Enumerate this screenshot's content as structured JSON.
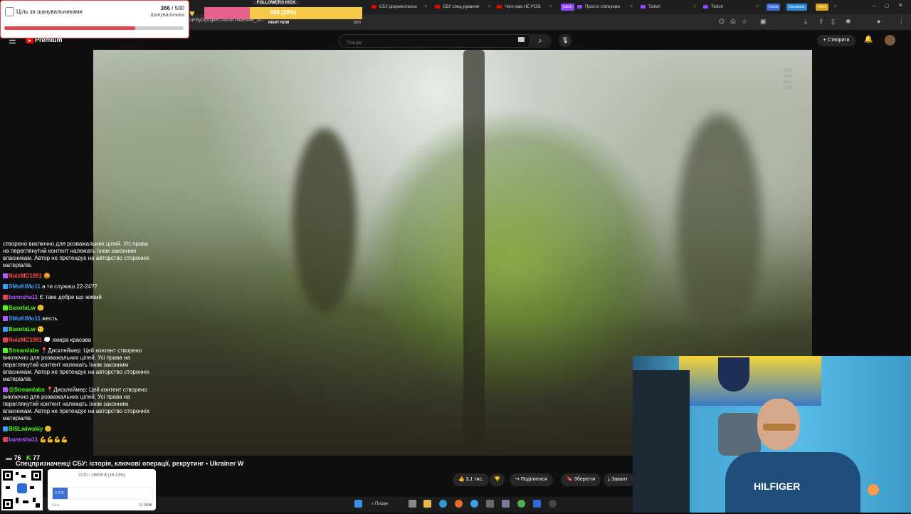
{
  "browser": {
    "tabs": [
      {
        "label": "СБУ документальн",
        "icon": "youtube-icon"
      },
      {
        "label": "СБУ спец-рування",
        "icon": "youtube-icon"
      },
      {
        "label": "Чого нам НЕ РОЗІ",
        "icon": "youtube-icon"
      },
      {
        "label": "Просто спілкуємо",
        "icon": "twitch-icon"
      },
      {
        "label": "Twitch",
        "icon": "twitch-icon"
      },
      {
        "label": "Twitch",
        "icon": "twitch-icon"
      }
    ],
    "pills": [
      "twitch",
      "Donat",
      "Donations",
      "Films"
    ],
    "url": "C4FByDIpUg4ECABAIK-ndaE8MB_2x..."
  },
  "follower_goal": {
    "title": "Ціль за шанувальниками",
    "current": "366",
    "total": "500",
    "label": "Шанувальники",
    "progress": 0.732
  },
  "followers_kick": {
    "label": "FOLLOWERS KICK",
    "value": "288 (28%)",
    "right_now": "RIGHT NOW",
    "max": "1000",
    "progress": 0.288
  },
  "youtube": {
    "logo": "Premium",
    "search_placeholder": "Пошук",
    "create_label": "Створити",
    "video_badge": [
      "RTX",
      "VSR",
      "RTX",
      "HDR"
    ],
    "title": "Спецпризначенці СБУ: історія, ключові операції, рекрутинг • Ukraїner W",
    "likes": "3,1 тис.",
    "share": "Поділитися",
    "save": "Зберегти",
    "download": "Завант"
  },
  "chat": {
    "stats": {
      "viewers": "76",
      "kick": "77"
    },
    "messages": [
      {
        "nick": "",
        "text": "створено виключно для розважальних цілей. Усі права на переглянутий контент належать їхнім законним власникам. Автор не претендує на авторство сторонніх матеріалів.",
        "color": "#ffffff"
      },
      {
        "nick": "NoizMC1991",
        "text": "😡",
        "color": "#ff4f4f"
      },
      {
        "nick": "SMoKiMo11",
        "text": "а ти служиш 22-24??",
        "color": "#3aa0ff"
      },
      {
        "nick": "bannsha11",
        "text": "Є таке добре що живий",
        "color": "#b05cff"
      },
      {
        "nick": "BasotaLw",
        "text": "🙂",
        "color": "#53fc18"
      },
      {
        "nick": "SMoKiMo11",
        "text": "жесть",
        "color": "#3aa0ff"
      },
      {
        "nick": "BasotaLw",
        "text": "🙂",
        "color": "#53fc18"
      },
      {
        "nick": "NoizMC1991",
        "text": "💭 хмара красава",
        "color": "#ff4f4f"
      },
      {
        "nick": "Streamlabs",
        "text": "📍Дисклеймер: Цей контент створено виключно для розважальних цілей. Усі права на переглянутий контент належать їхнім законним власникам. Автор не претендує на авторство сторонніх матеріалів.",
        "color": "#53fc18"
      },
      {
        "nick": "@Streamlabs",
        "text": "📍Дисклеймер: Цей контент створено виключно для розважальних цілей. Усі права на переглянутий контент належать їхнім законним власникам. Автор не претендує на авторство сторонніх матеріалів.",
        "color": "#53fc18"
      },
      {
        "nick": "BISLwiwskiy",
        "text": "🙂",
        "color": "#53fc18"
      },
      {
        "nick": "bannsha11",
        "text": "💪💪💪💪",
        "color": "#b05cff"
      }
    ]
  },
  "donation": {
    "title": "2270 / 15000 ₴ (15.13%)",
    "fill_label": "2 270",
    "goal_label": "Ціль",
    "max": "15 000₴",
    "progress": 0.1513
  },
  "taskbar": {
    "search": "Пошук"
  }
}
